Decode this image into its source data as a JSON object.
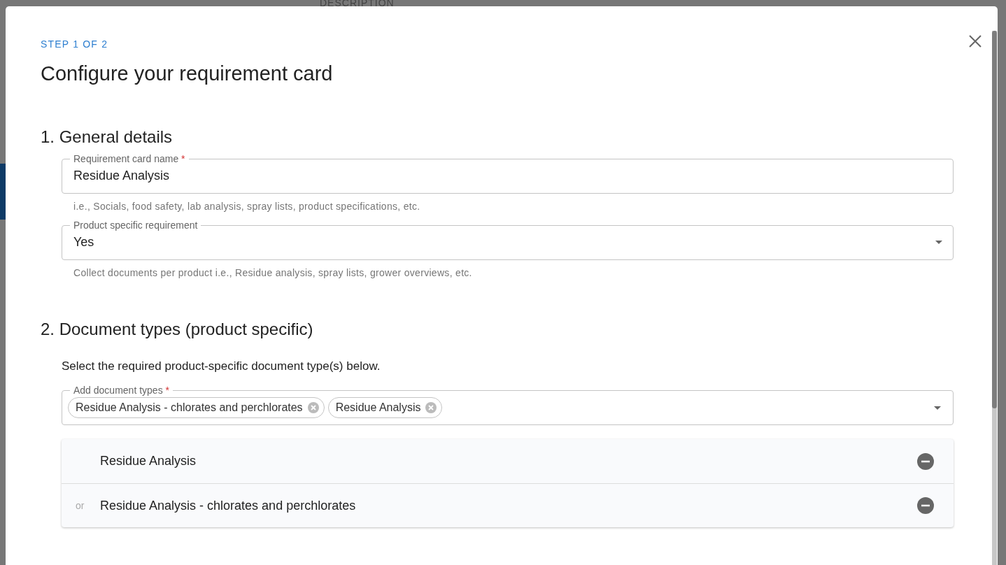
{
  "background": {
    "column_header": "DESCRIPTION"
  },
  "dialog": {
    "step": "STEP 1 OF 2",
    "title": "Configure your requirement card"
  },
  "sections": [
    {
      "title": "1. General details",
      "fields": [
        {
          "kind": "text",
          "label": "Requirement card name",
          "required_mark": "*",
          "value": "Residue Analysis",
          "helper": "i.e., Socials, food safety, lab analysis, spray lists, product specifications, etc."
        },
        {
          "kind": "select",
          "label": "Product specific requirement",
          "value": "Yes",
          "helper": "Collect documents per product i.e., Residue analysis, spray lists, grower overviews, etc."
        }
      ]
    },
    {
      "title": "2. Document types (product specific)",
      "intro": "Select the required product-specific document type(s) below.",
      "multiselect": {
        "label": "Add document types",
        "required_mark": "*",
        "chips": [
          "Residue Analysis - chlorates and perchlorates",
          "Residue Analysis"
        ]
      },
      "list": [
        {
          "name": "Residue Analysis"
        },
        {
          "prefix": "or",
          "name": "Residue Analysis - chlorates and perchlorates"
        }
      ]
    }
  ]
}
